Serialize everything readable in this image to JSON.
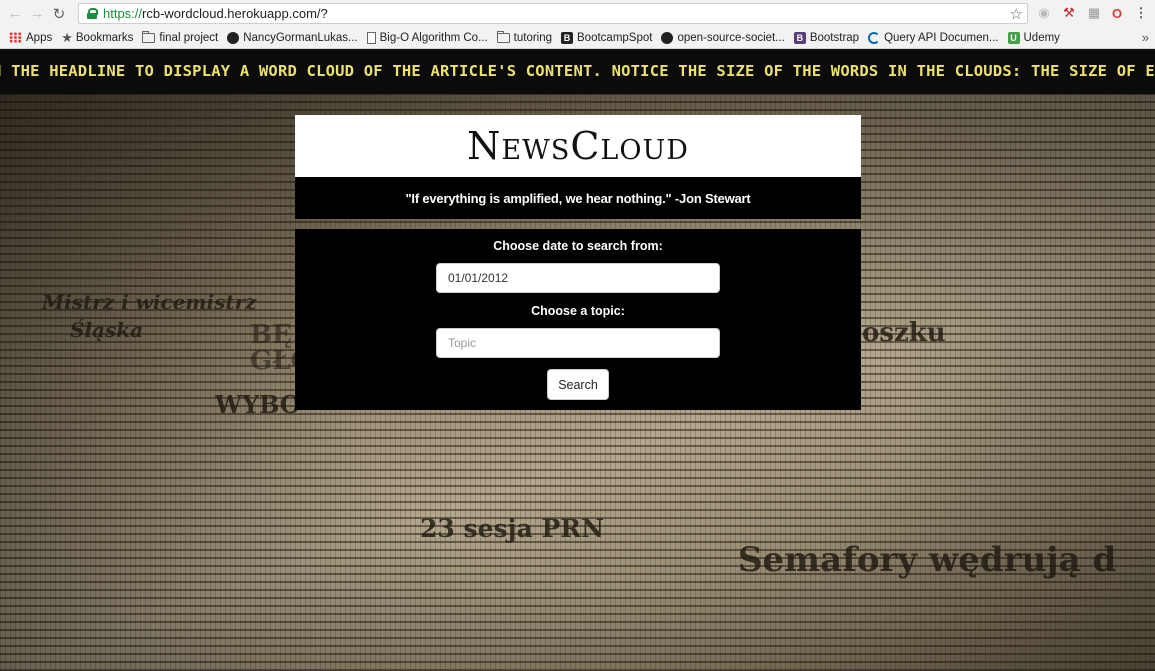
{
  "browser": {
    "url_scheme": "https://",
    "url_rest": "rcb-wordcloud.herokuapp.com/?",
    "bookmarks": [
      {
        "label": "Apps",
        "icon": "apps-grid-icon"
      },
      {
        "label": "Bookmarks",
        "icon": "star-icon"
      },
      {
        "label": "final project",
        "icon": "folder-icon"
      },
      {
        "label": "NancyGormanLukas...",
        "icon": "github-icon"
      },
      {
        "label": "Big-O Algorithm Co...",
        "icon": "document-icon"
      },
      {
        "label": "tutoring",
        "icon": "folder-icon"
      },
      {
        "label": "BootcampSpot",
        "icon": "bootcampspot-icon"
      },
      {
        "label": "open-source-societ...",
        "icon": "github-icon"
      },
      {
        "label": "Bootstrap",
        "icon": "bootstrap-icon"
      },
      {
        "label": "Query API Documen...",
        "icon": "jquery-icon"
      },
      {
        "label": "Udemy",
        "icon": "udemy-icon"
      }
    ],
    "overflow_label": "»"
  },
  "ticker": {
    "text": "N THE HEADLINE TO DISPLAY A WORD CLOUD OF THE ARTICLE'S CONTENT. NOTICE THE SIZE OF THE WORDS IN THE CLOUDS: THE SIZE OF EACH W"
  },
  "background_headlines": {
    "h1": "Mistrz i wicemistrz",
    "h2": "Śląska",
    "h3": "23 sesja PRN",
    "h4": "Semafory wędrują d",
    "h5": "oszku",
    "h6": "WYBO",
    "h7": "BĘ",
    "h8": "GŁO"
  },
  "header": {
    "title": "NewsCloud",
    "quote": "\"If everything is amplified, we hear nothing.\" -Jon Stewart"
  },
  "form": {
    "date_label": "Choose date to search from:",
    "date_value": "01/01/2012",
    "topic_label": "Choose a topic:",
    "topic_placeholder": "Topic",
    "search_label": "Search"
  },
  "colors": {
    "ticker_text": "#ece06e",
    "panel_bg": "#000000"
  }
}
